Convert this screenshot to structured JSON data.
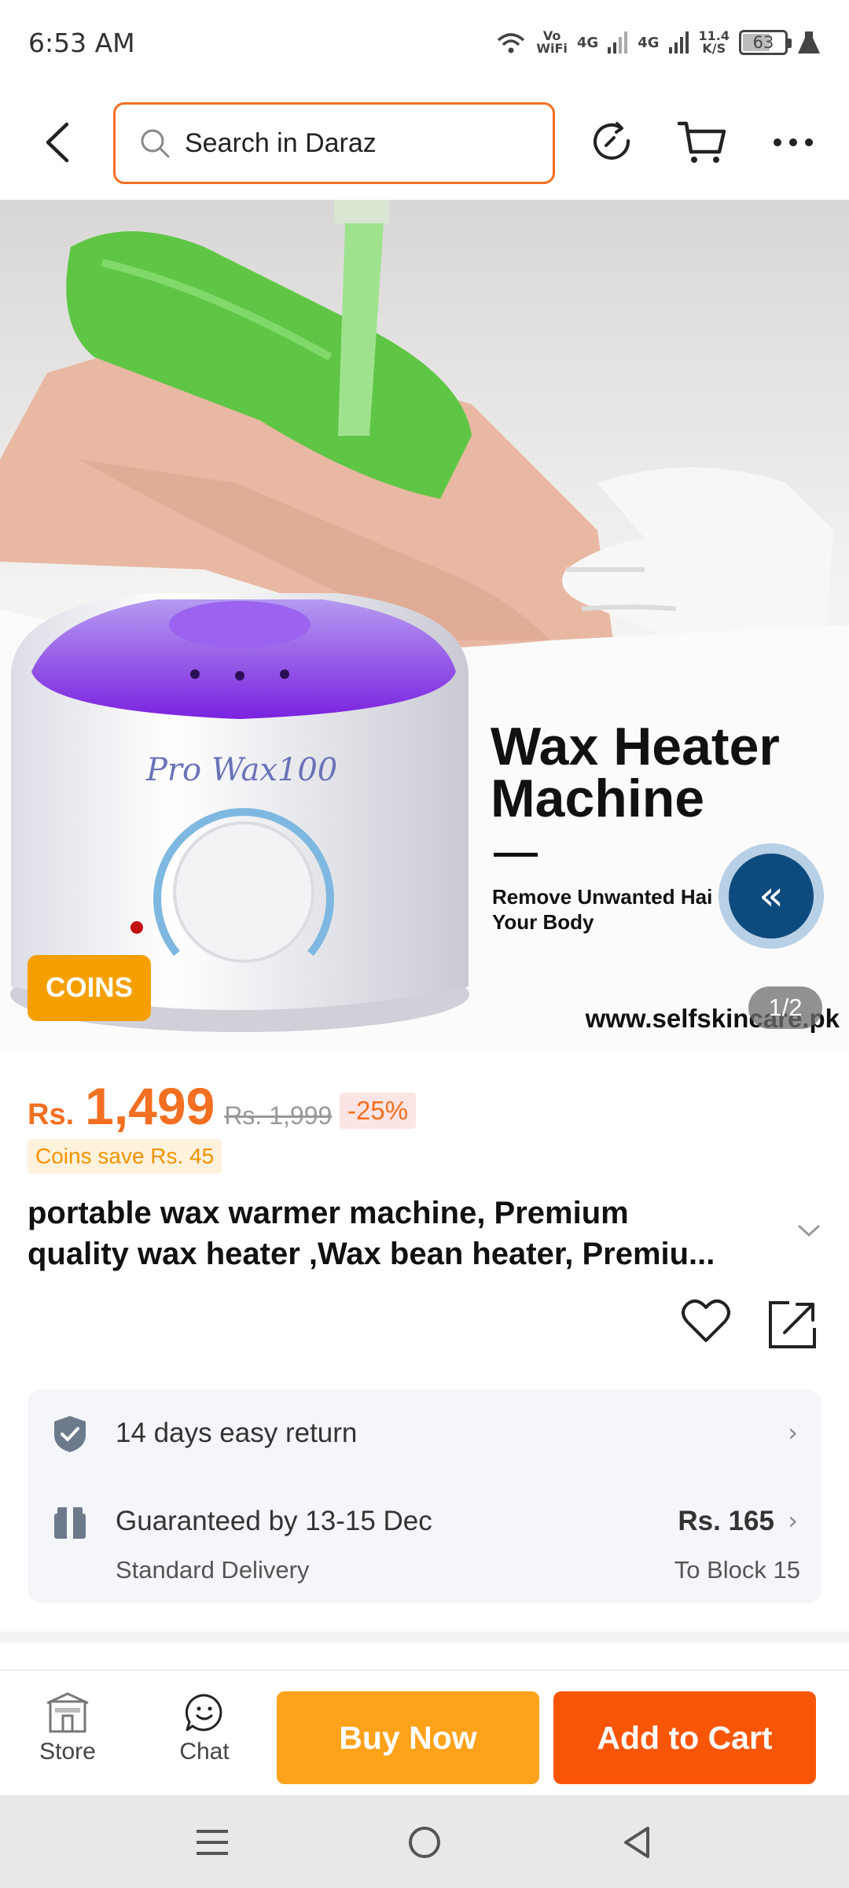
{
  "status_bar": {
    "time": "6:53 AM",
    "vowifi_top": "Vo",
    "vowifi_bottom": "WiFi",
    "sim1": "4G",
    "sim2": "4G",
    "speed_value": "11.4",
    "speed_unit": "K/S",
    "battery": "63"
  },
  "header": {
    "search_placeholder": "Search in Daraz"
  },
  "hero": {
    "brand_mark": "Pro Wax100",
    "title_line1": "Wax Heater",
    "title_line2": "Machine",
    "subtitle_line1": "Remove Unwanted Hai",
    "subtitle_line2": "Your Body",
    "url": "www.selfskincare.pk",
    "coins_badge": "COINS",
    "image_counter": "1/2",
    "collapse_glyph": "«"
  },
  "product": {
    "currency": "Rs.",
    "price": "1,499",
    "old_price": "Rs. 1,999",
    "discount": "-25%",
    "coins_save": "Coins save Rs. 45",
    "title_line1": "portable wax warmer machine, Premium",
    "title_line2": "quality wax heater ,Wax bean heater, Premiu..."
  },
  "services": {
    "return_text": "14 days easy return",
    "delivery_text": "Guaranteed by 13-15 Dec",
    "delivery_sub": "Standard Delivery",
    "delivery_fee": "Rs. 165",
    "delivery_to": "To Block 15"
  },
  "bottom_bar": {
    "store_label": "Store",
    "chat_label": "Chat",
    "buy_now": "Buy Now",
    "add_to_cart": "Add to Cart"
  },
  "colors": {
    "accent_orange": "#f36f21",
    "buy_now": "#fea21a",
    "add_to_cart": "#f85606",
    "coins_badge": "#f5a000"
  }
}
